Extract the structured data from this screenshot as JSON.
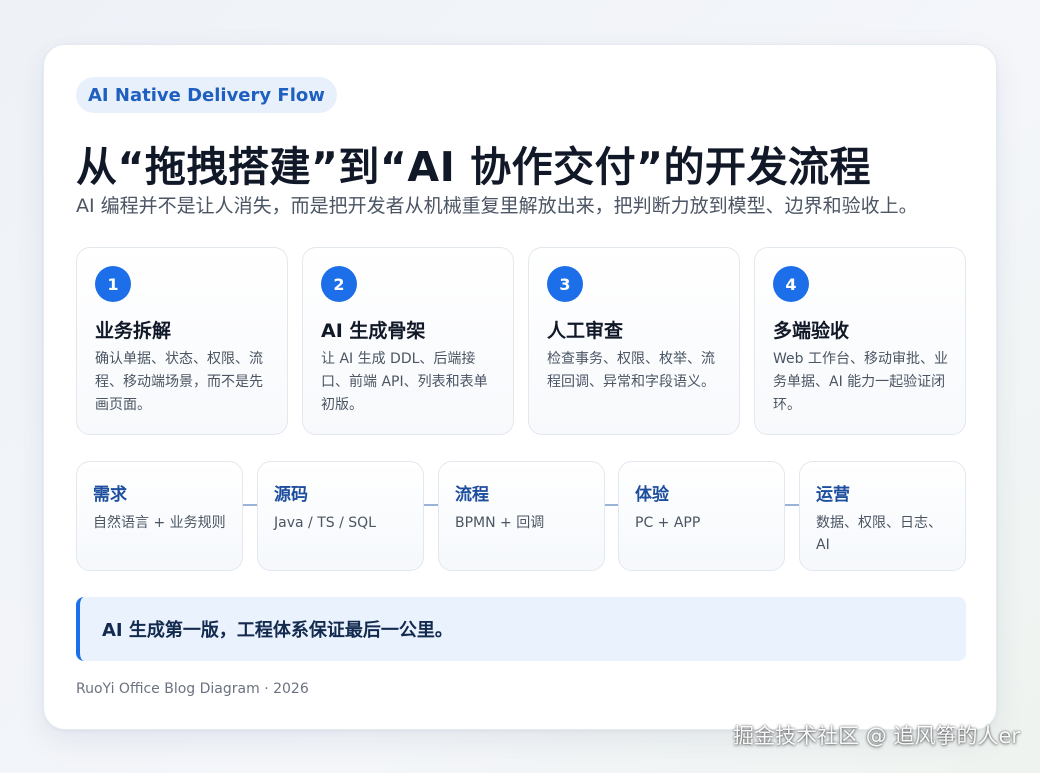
{
  "badge": "AI Native Delivery Flow",
  "title": "从“拖拽搭建”到“AI 协作交付”的开发流程",
  "subtitle": "AI 编程并不是让人消失，而是把开发者从机械重复里解放出来，把判断力放到模型、边界和验收上。",
  "steps": [
    {
      "num": "1",
      "title": "业务拆解",
      "desc": "确认单据、状态、权限、流程、移动端场景，而不是先画页面。"
    },
    {
      "num": "2",
      "title": "AI 生成骨架",
      "desc": "让 AI 生成 DDL、后端接口、前端 API、列表和表单初版。"
    },
    {
      "num": "3",
      "title": "人工审查",
      "desc": "检查事务、权限、枚举、流程回调、异常和字段语义。"
    },
    {
      "num": "4",
      "title": "多端验收",
      "desc": "Web 工作台、移动审批、业务单据、AI 能力一起验证闭环。"
    }
  ],
  "pipeline": [
    {
      "title": "需求",
      "desc": "自然语言 + 业务规则"
    },
    {
      "title": "源码",
      "desc": "Java / TS / SQL"
    },
    {
      "title": "流程",
      "desc": "BPMN + 回调"
    },
    {
      "title": "体验",
      "desc": "PC + APP"
    },
    {
      "title": "运营",
      "desc": "数据、权限、日志、AI"
    }
  ],
  "callout": "AI 生成第一版，工程体系保证最后一公里。",
  "footer": "RuoYi Office Blog Diagram · 2026",
  "watermark": "掘金技术社区 @ 追风筝的人er",
  "colors": {
    "accent": "#1c6fe8",
    "stage_title": "#1d4e9e",
    "badge_bg": "#e8f0fc"
  }
}
